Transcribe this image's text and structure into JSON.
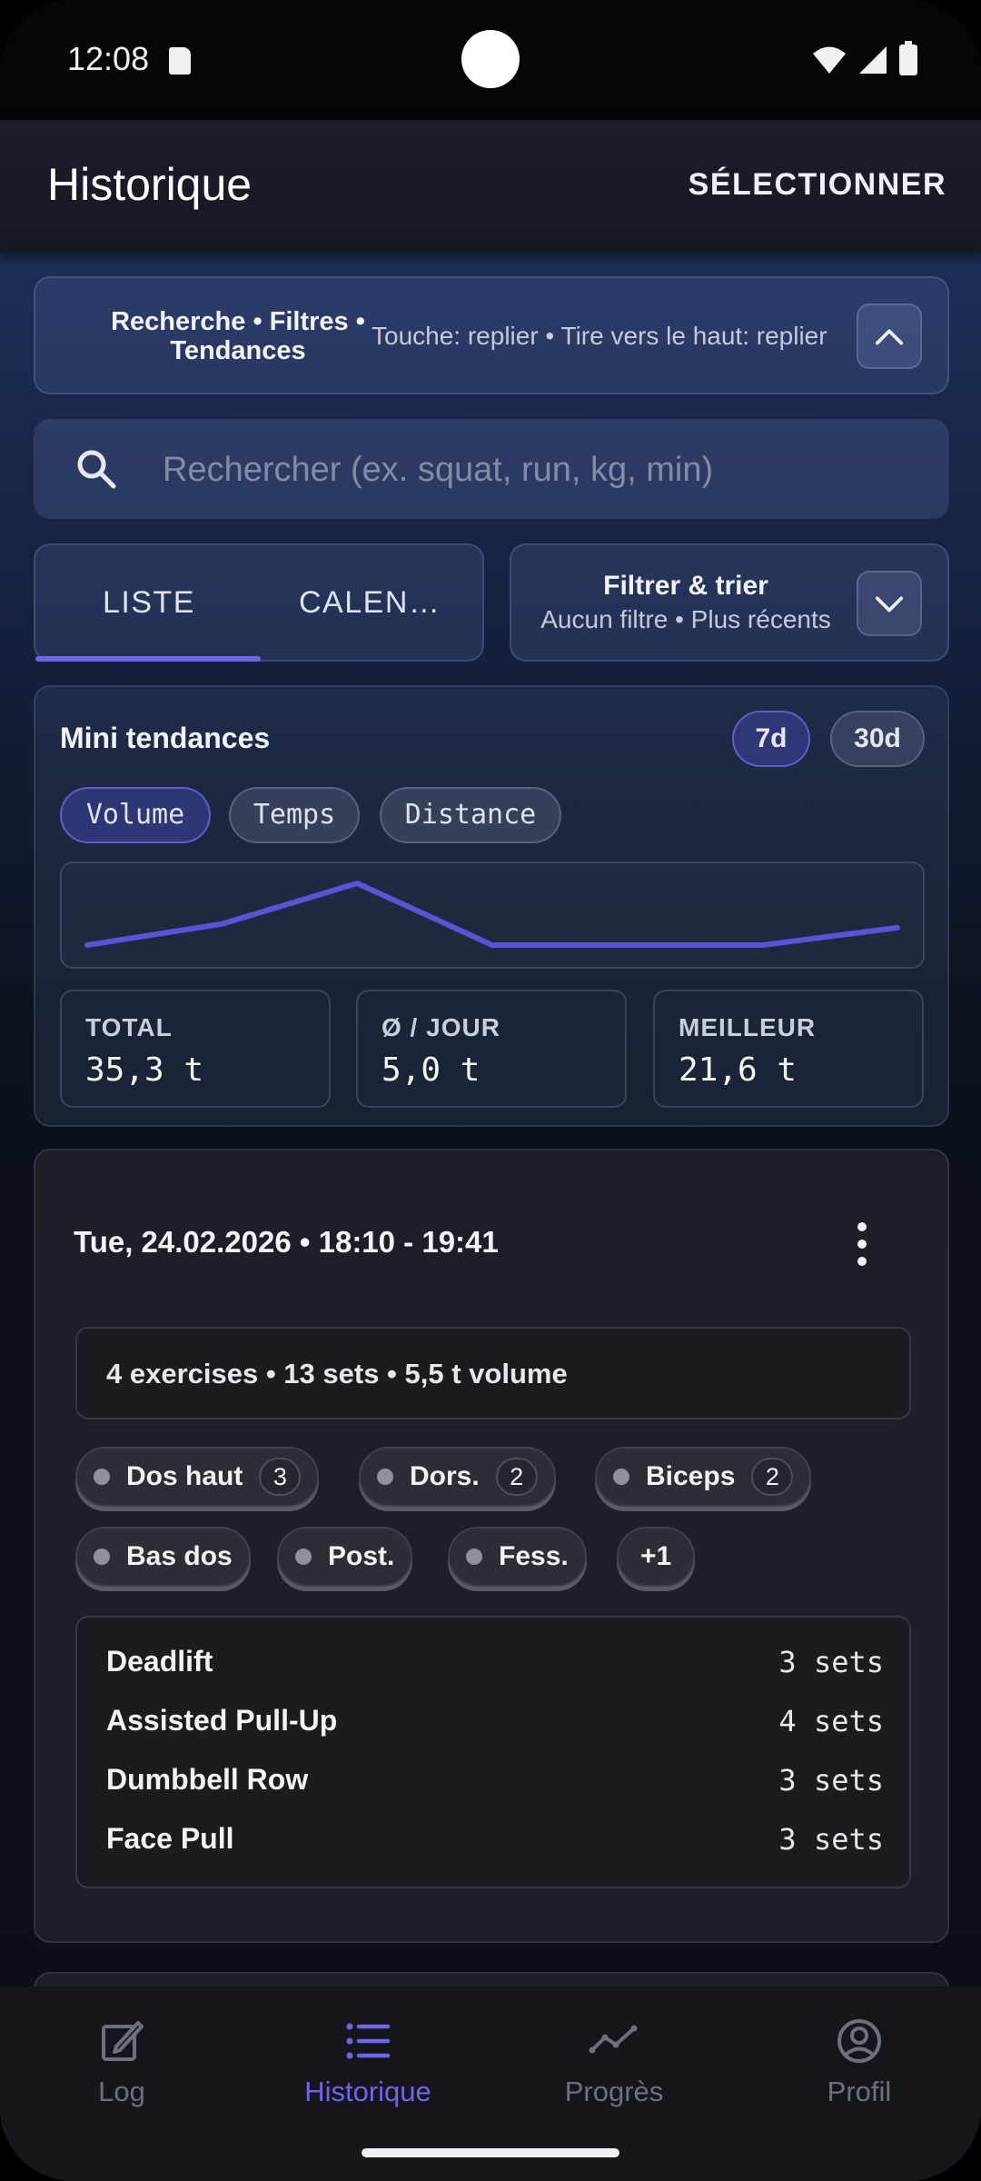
{
  "status_bar": {
    "time": "12:08"
  },
  "app_bar": {
    "title": "Historique",
    "action": "SÉLECTIONNER"
  },
  "collapse_panel": {
    "title_line1": "Recherche • Filtres •",
    "title_line2": "Tendances",
    "hint": "Touche: replier • Tire vers le haut: replier",
    "toggle_icon": "chevron-up-icon"
  },
  "search": {
    "placeholder": "Rechercher (ex. squat, run, kg, min)",
    "value": ""
  },
  "view_tabs": {
    "list_label": "LISTE",
    "calendar_label": "CALEN…",
    "active": "list"
  },
  "filter": {
    "title": "Filtrer & trier",
    "subtitle": "Aucun filtre • Plus récents",
    "toggle_icon": "chevron-down-icon"
  },
  "trends": {
    "title": "Mini tendances",
    "ranges": [
      "7d",
      "30d"
    ],
    "active_range": "7d",
    "metrics": [
      "Volume",
      "Temps",
      "Distance"
    ],
    "active_metric": "Volume",
    "sparkline_values": [
      0.0,
      1.1,
      3.2,
      0.0,
      0.0,
      0.0,
      0.9
    ],
    "line_color": "#5b52d6",
    "stats": [
      {
        "label": "TOTAL",
        "value": "35,3 t"
      },
      {
        "label": "Ø / JOUR",
        "value": "5,0 t"
      },
      {
        "label": "MEILLEUR",
        "value": "21,6 t"
      }
    ]
  },
  "workout": {
    "date": "Tue, 24.02.2026 • 18:10 - 19:41",
    "summary": "4 exercises • 13 sets • 5,5 t volume",
    "muscles": [
      {
        "name": "Dos haut",
        "count": "3"
      },
      {
        "name": "Dors.",
        "count": "2"
      },
      {
        "name": "Biceps",
        "count": "2"
      },
      {
        "name": "Bas dos",
        "count": ""
      },
      {
        "name": "Post.",
        "count": ""
      },
      {
        "name": "Fess.",
        "count": ""
      }
    ],
    "more_chip": "+1",
    "exercises": [
      {
        "name": "Deadlift",
        "sets": "3 sets"
      },
      {
        "name": "Assisted Pull-Up",
        "sets": "4 sets"
      },
      {
        "name": "Dumbbell Row",
        "sets": "3 sets"
      },
      {
        "name": "Face Pull",
        "sets": "3 sets"
      }
    ]
  },
  "bottom_nav": {
    "items": [
      {
        "label": "Log",
        "icon": "edit-icon"
      },
      {
        "label": "Historique",
        "icon": "list-icon"
      },
      {
        "label": "Progrès",
        "icon": "trend-icon"
      },
      {
        "label": "Profil",
        "icon": "profile-icon"
      }
    ],
    "active": "Historique",
    "active_color": "#6f66e6"
  }
}
